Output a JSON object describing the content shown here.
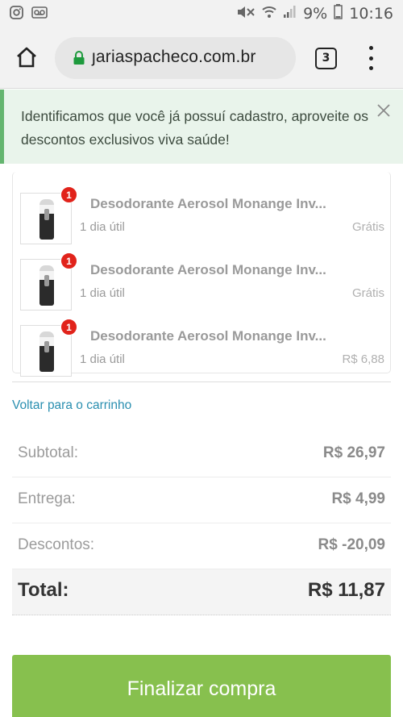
{
  "status_bar": {
    "battery": "9%",
    "time": "10:16",
    "left_icons": [
      "instagram-icon",
      "voicemail-icon"
    ],
    "right_icons": [
      "mute-icon",
      "wifi-icon",
      "signal-icon",
      "battery-icon"
    ]
  },
  "browser": {
    "url": "garias pacheco.com.br",
    "url_display": "ȷariaspacheco.com.br",
    "tab_count": "3"
  },
  "notice": {
    "text": "Identificamos que você já possuí cadastro, aproveite os descontos exclusivos viva saúde!"
  },
  "items": [
    {
      "name": "Desodorante Aerosol Monange Inv...",
      "eta": "1 dia útil",
      "price": "Grátis",
      "qty": "1"
    },
    {
      "name": "Desodorante Aerosol Monange Inv...",
      "eta": "1 dia útil",
      "price": "Grátis",
      "qty": "1"
    },
    {
      "name": "Desodorante Aerosol Monange Inv...",
      "eta": "1 dia útil",
      "price": "R$ 6,88",
      "qty": "1"
    }
  ],
  "back_link": "Voltar para o carrinho",
  "totals": {
    "subtotal_label": "Subtotal:",
    "subtotal_value": "R$ 26,97",
    "delivery_label": "Entrega:",
    "delivery_value": "R$ 4,99",
    "discount_label": "Descontos:",
    "discount_value": "R$ -20,09",
    "total_label": "Total:",
    "total_value": "R$ 11,87"
  },
  "checkout_button": "Finalizar compra",
  "colors": {
    "accent_green": "#87c04e",
    "notice_bg": "#e9f4eb",
    "notice_border": "#64b56f",
    "badge_red": "#e1231b",
    "link_blue": "#2a8fb0"
  }
}
